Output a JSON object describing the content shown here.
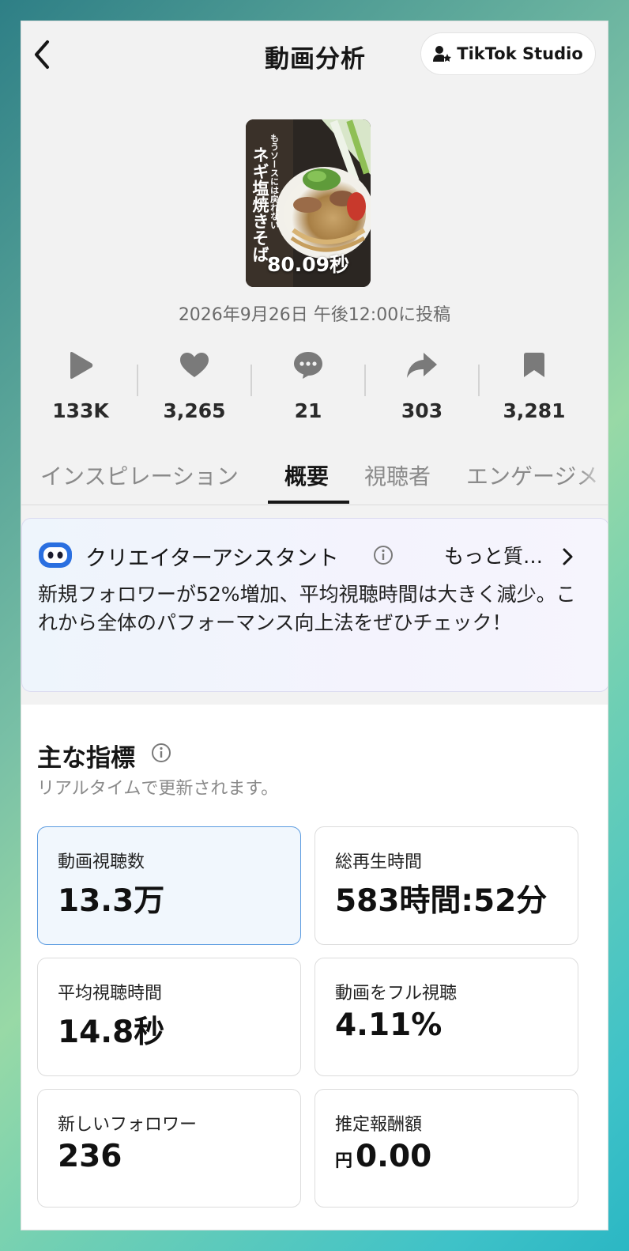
{
  "header": {
    "title": "動画分析",
    "studio_label": "TikTok Studio"
  },
  "video": {
    "thumbnail_caption_top": "もうソースには戻れない",
    "thumbnail_caption_main": "ネギ塩焼きそば",
    "duration": "80.09秒",
    "posted_at": "2026年9月26日 午後12:00に投稿"
  },
  "stats": [
    {
      "icon": "play-icon",
      "value": "133K"
    },
    {
      "icon": "heart-icon",
      "value": "3,265"
    },
    {
      "icon": "comment-icon",
      "value": "21"
    },
    {
      "icon": "share-icon",
      "value": "303"
    },
    {
      "icon": "bookmark-icon",
      "value": "3,281"
    }
  ],
  "tabs": [
    {
      "label": "インスピレーション",
      "active": false
    },
    {
      "label": "概要",
      "active": true
    },
    {
      "label": "視聴者",
      "active": false
    },
    {
      "label": "エンゲージメ",
      "active": false
    }
  ],
  "assistant": {
    "title": "クリエイターアシスタント",
    "more_label": "もっと質…",
    "message": "新規フォロワーが52%増加、平均視聴時間は大きく減少。これから全体のパフォーマンス向上法をぜひチェック！"
  },
  "metrics": {
    "title": "主な指標",
    "subtitle": "リアルタイムで更新されます。",
    "cards": [
      {
        "label": "動画視聴数",
        "value": "13.3万",
        "selected": true
      },
      {
        "label": "総再生時間",
        "value": "583時間:52分",
        "selected": false
      },
      {
        "label": "平均視聴時間",
        "value": "14.8秒",
        "selected": false
      },
      {
        "label": "動画をフル視聴",
        "value": "4.11%",
        "selected": false
      },
      {
        "label": "新しいフォロワー",
        "value": "236",
        "selected": false
      },
      {
        "label": "推定報酬額",
        "currency": "円",
        "value": "0.00",
        "selected": false
      }
    ]
  }
}
